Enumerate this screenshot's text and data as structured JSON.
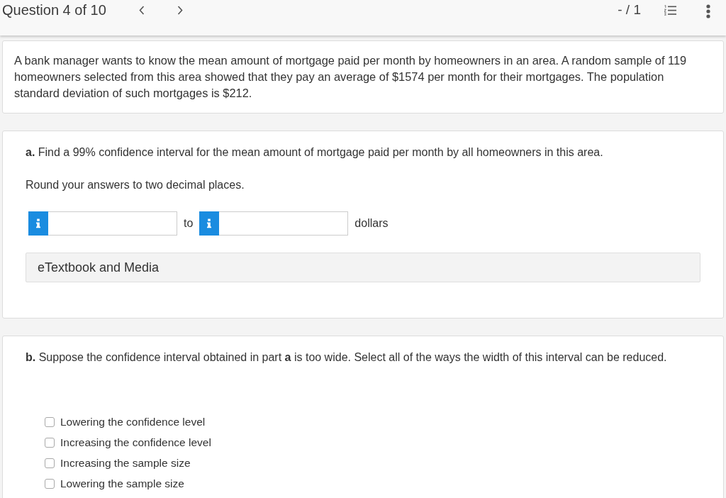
{
  "header": {
    "title": "Question 4 of 10",
    "score": "- / 1"
  },
  "question": {
    "text": "A bank manager wants to know the mean amount of mortgage paid per month by homeowners in an area. A random sample of 119 homeowners selected from this area showed that they pay an average of $1574 per month for their mortgages. The population standard deviation of such mortgages is $212."
  },
  "parts": [
    {
      "kind": "interval",
      "prompt": "**a.** Find a 99% confidence interval for the mean amount of mortgage paid per month by all homeowners in this area.",
      "instruction": "Round your answers to two decimal places.",
      "joiner": "to",
      "unit": "dollars",
      "resources": "eTextbook and Media"
    },
    {
      "kind": "choices",
      "prompt": "**b.** Suppose the confidence interval obtained in part **a** is too wide. Select all of the ways the width of this interval can be reduced.",
      "options": [
        {
          "label": "Lowering the confidence level",
          "checked": false
        },
        {
          "label": "Increasing the confidence level",
          "checked": false
        },
        {
          "label": "Increasing the sample size",
          "checked": false
        },
        {
          "label": "Lowering the sample size",
          "checked": false
        }
      ]
    }
  ]
}
